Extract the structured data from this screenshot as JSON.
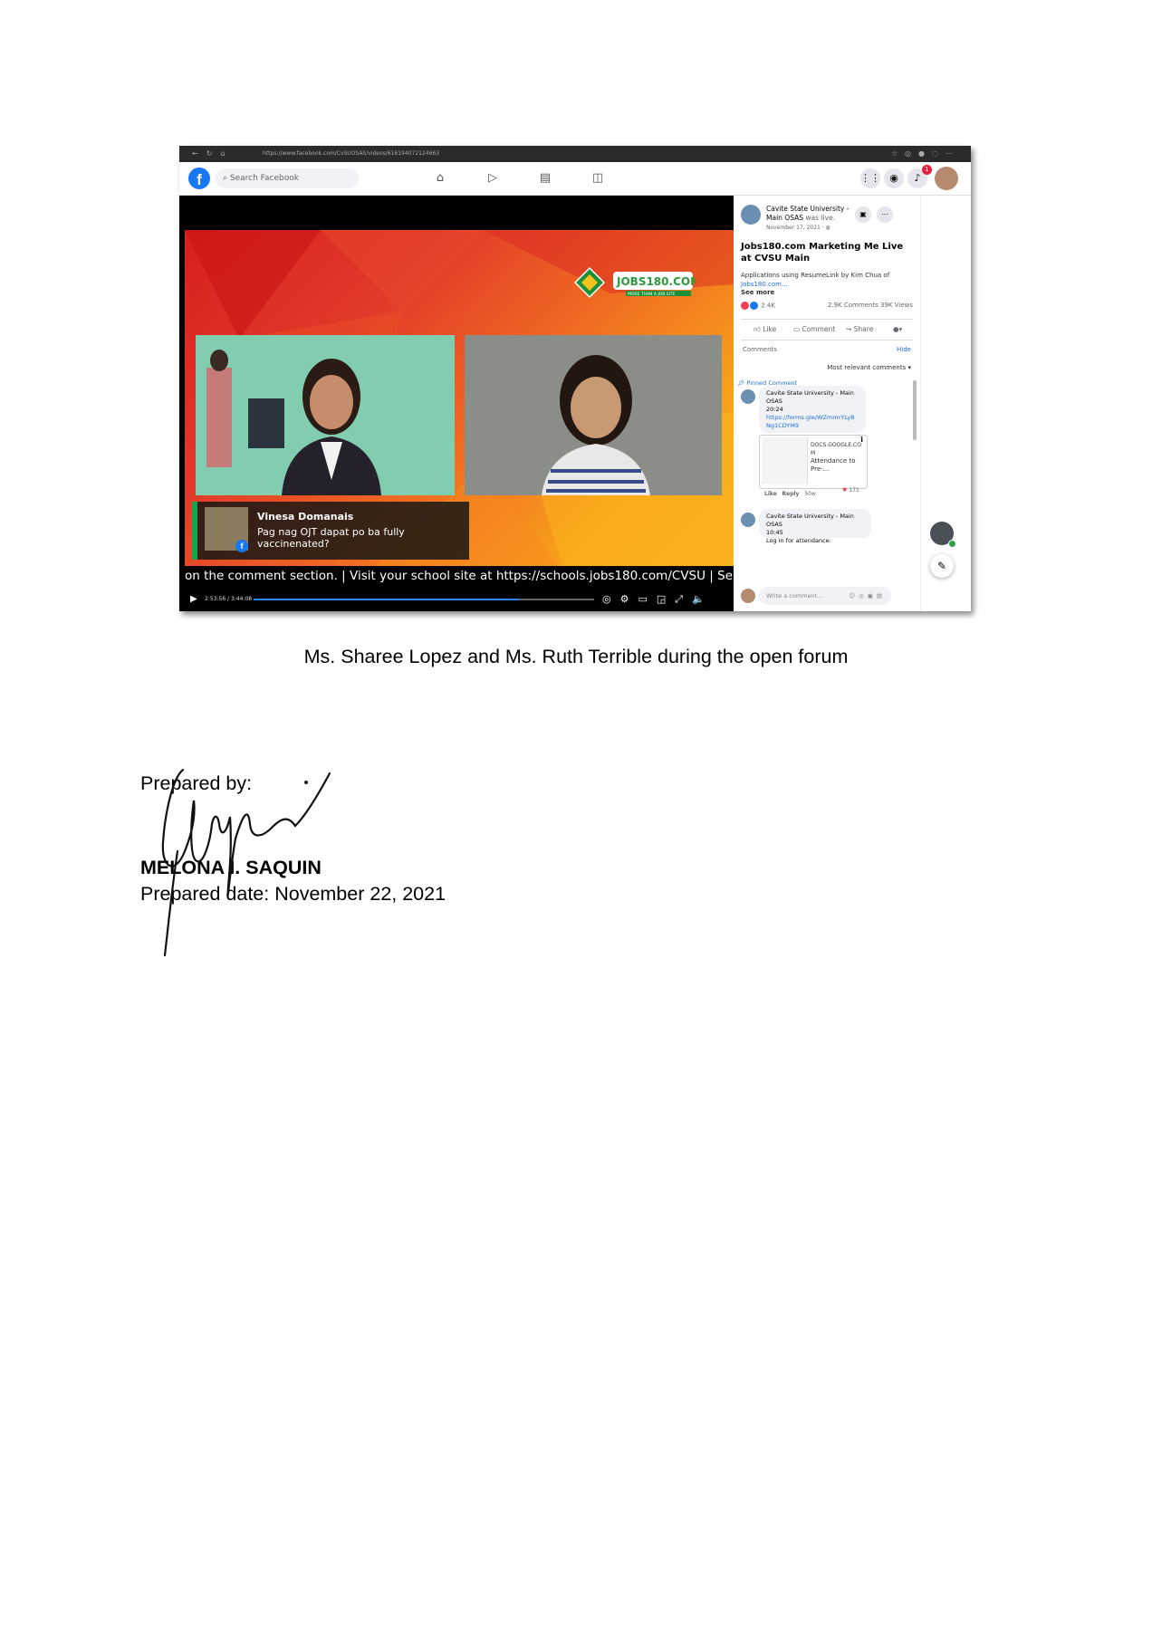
{
  "browser": {
    "url": "https://www.facebook.com/CvSUOSAS/videos/616194072124663"
  },
  "facebook": {
    "logo": "f",
    "search_placeholder": "Search Facebook",
    "nav_icons": [
      "home-icon",
      "watch-icon",
      "marketplace-icon",
      "gaming-icon"
    ],
    "notification_count": "1"
  },
  "video": {
    "logo_text": "JOBS180.COM",
    "logo_tagline": "MORE THAN A JOB SITE",
    "comment_card": {
      "name": "Vinesa Domanais",
      "text": "Pag nag OJT dapat po ba fully vaccinenated?"
    },
    "ticker": "on the comment section. | Visit your school site at https://schools.jobs180.com/CVSU | Send in your qu",
    "time": "2:53:56 / 3:44:08",
    "progress": 0.78
  },
  "post": {
    "page_name": "Cavite State University - Main OSAS",
    "status": "was live.",
    "date": "November 17, 2021 · ",
    "title": "Jobs180.com Marketing Me Live at CVSU Main",
    "description": "Applications using ResumeLink by Kim Chua of ",
    "description_link": "Jobs180.com...",
    "see_more": "See more",
    "reactions": "2.4K",
    "comments_count": "2.9K Comments",
    "views": "39K Views",
    "actions": [
      "Like",
      "Comment",
      "Share"
    ],
    "comments_label": "Comments",
    "hide_label": "Hide",
    "sort_label": "Most relevant comments",
    "pinned_label": "Pinned Comment",
    "pinned_comment": {
      "author": "Cavite State University - Main OSAS",
      "time": "20:24",
      "link": "https://forms.gle/WZmmrYLyBNg1CDYM9",
      "preview_domain": "DOCS.GOOGLE.COM",
      "preview_title": "Attendance to Pre-...",
      "like": "Like",
      "reply": "Reply",
      "age": "50w",
      "count": "171"
    },
    "second_comment": {
      "author": "Cavite State University - Main OSAS",
      "time": "10:45",
      "text": "Log in for attendance:"
    },
    "write_placeholder": "Write a comment..."
  },
  "document": {
    "caption": "Ms. Sharee Lopez and Ms. Ruth Terrible during the open forum",
    "prepared_by_label": "Prepared by:",
    "preparer_name": "MELONA I. SAQUIN",
    "prepared_date": "Prepared date: November 22, 2021"
  },
  "colors": {
    "facebook_blue": "#1877f2",
    "link_blue": "#216fdb",
    "video_red": "#d81f1f",
    "video_orange": "#f7a21a"
  }
}
